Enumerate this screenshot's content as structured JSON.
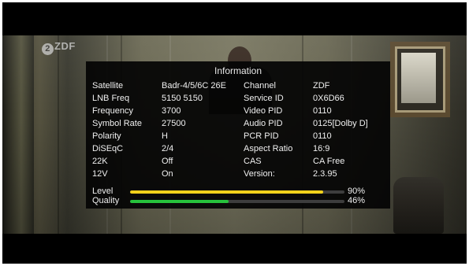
{
  "channel_logo": "ZDF",
  "info_panel": {
    "title": "Information",
    "rows": [
      {
        "label1": "Satellite",
        "value1": "Badr-4/5/6C 26E",
        "label2": "Channel",
        "value2": "ZDF"
      },
      {
        "label1": "LNB Freq",
        "value1": "5150 5150",
        "label2": "Service ID",
        "value2": "0X6D66"
      },
      {
        "label1": "Frequency",
        "value1": "3700",
        "label2": "Video PID",
        "value2": "0110"
      },
      {
        "label1": "Symbol Rate",
        "value1": "27500",
        "label2": "Audio PID",
        "value2": "0125[Dolby D]"
      },
      {
        "label1": "Polarity",
        "value1": "H",
        "label2": "PCR PID",
        "value2": "0110"
      },
      {
        "label1": "DiSEqC",
        "value1": "2/4",
        "label2": "Aspect Ratio",
        "value2": "16:9"
      },
      {
        "label1": "22K",
        "value1": "Off",
        "label2": "CAS",
        "value2": "CA Free"
      },
      {
        "label1": "12V",
        "value1": "On",
        "label2": "Version:",
        "value2": "2.3.95"
      }
    ],
    "signal": {
      "level": {
        "label": "Level",
        "percent_text": "90%",
        "value": 0.9,
        "color": "#f2d21b"
      },
      "quality": {
        "label": "Quality",
        "percent_text": "46%",
        "value": 0.46,
        "color": "#27c23c"
      }
    }
  }
}
